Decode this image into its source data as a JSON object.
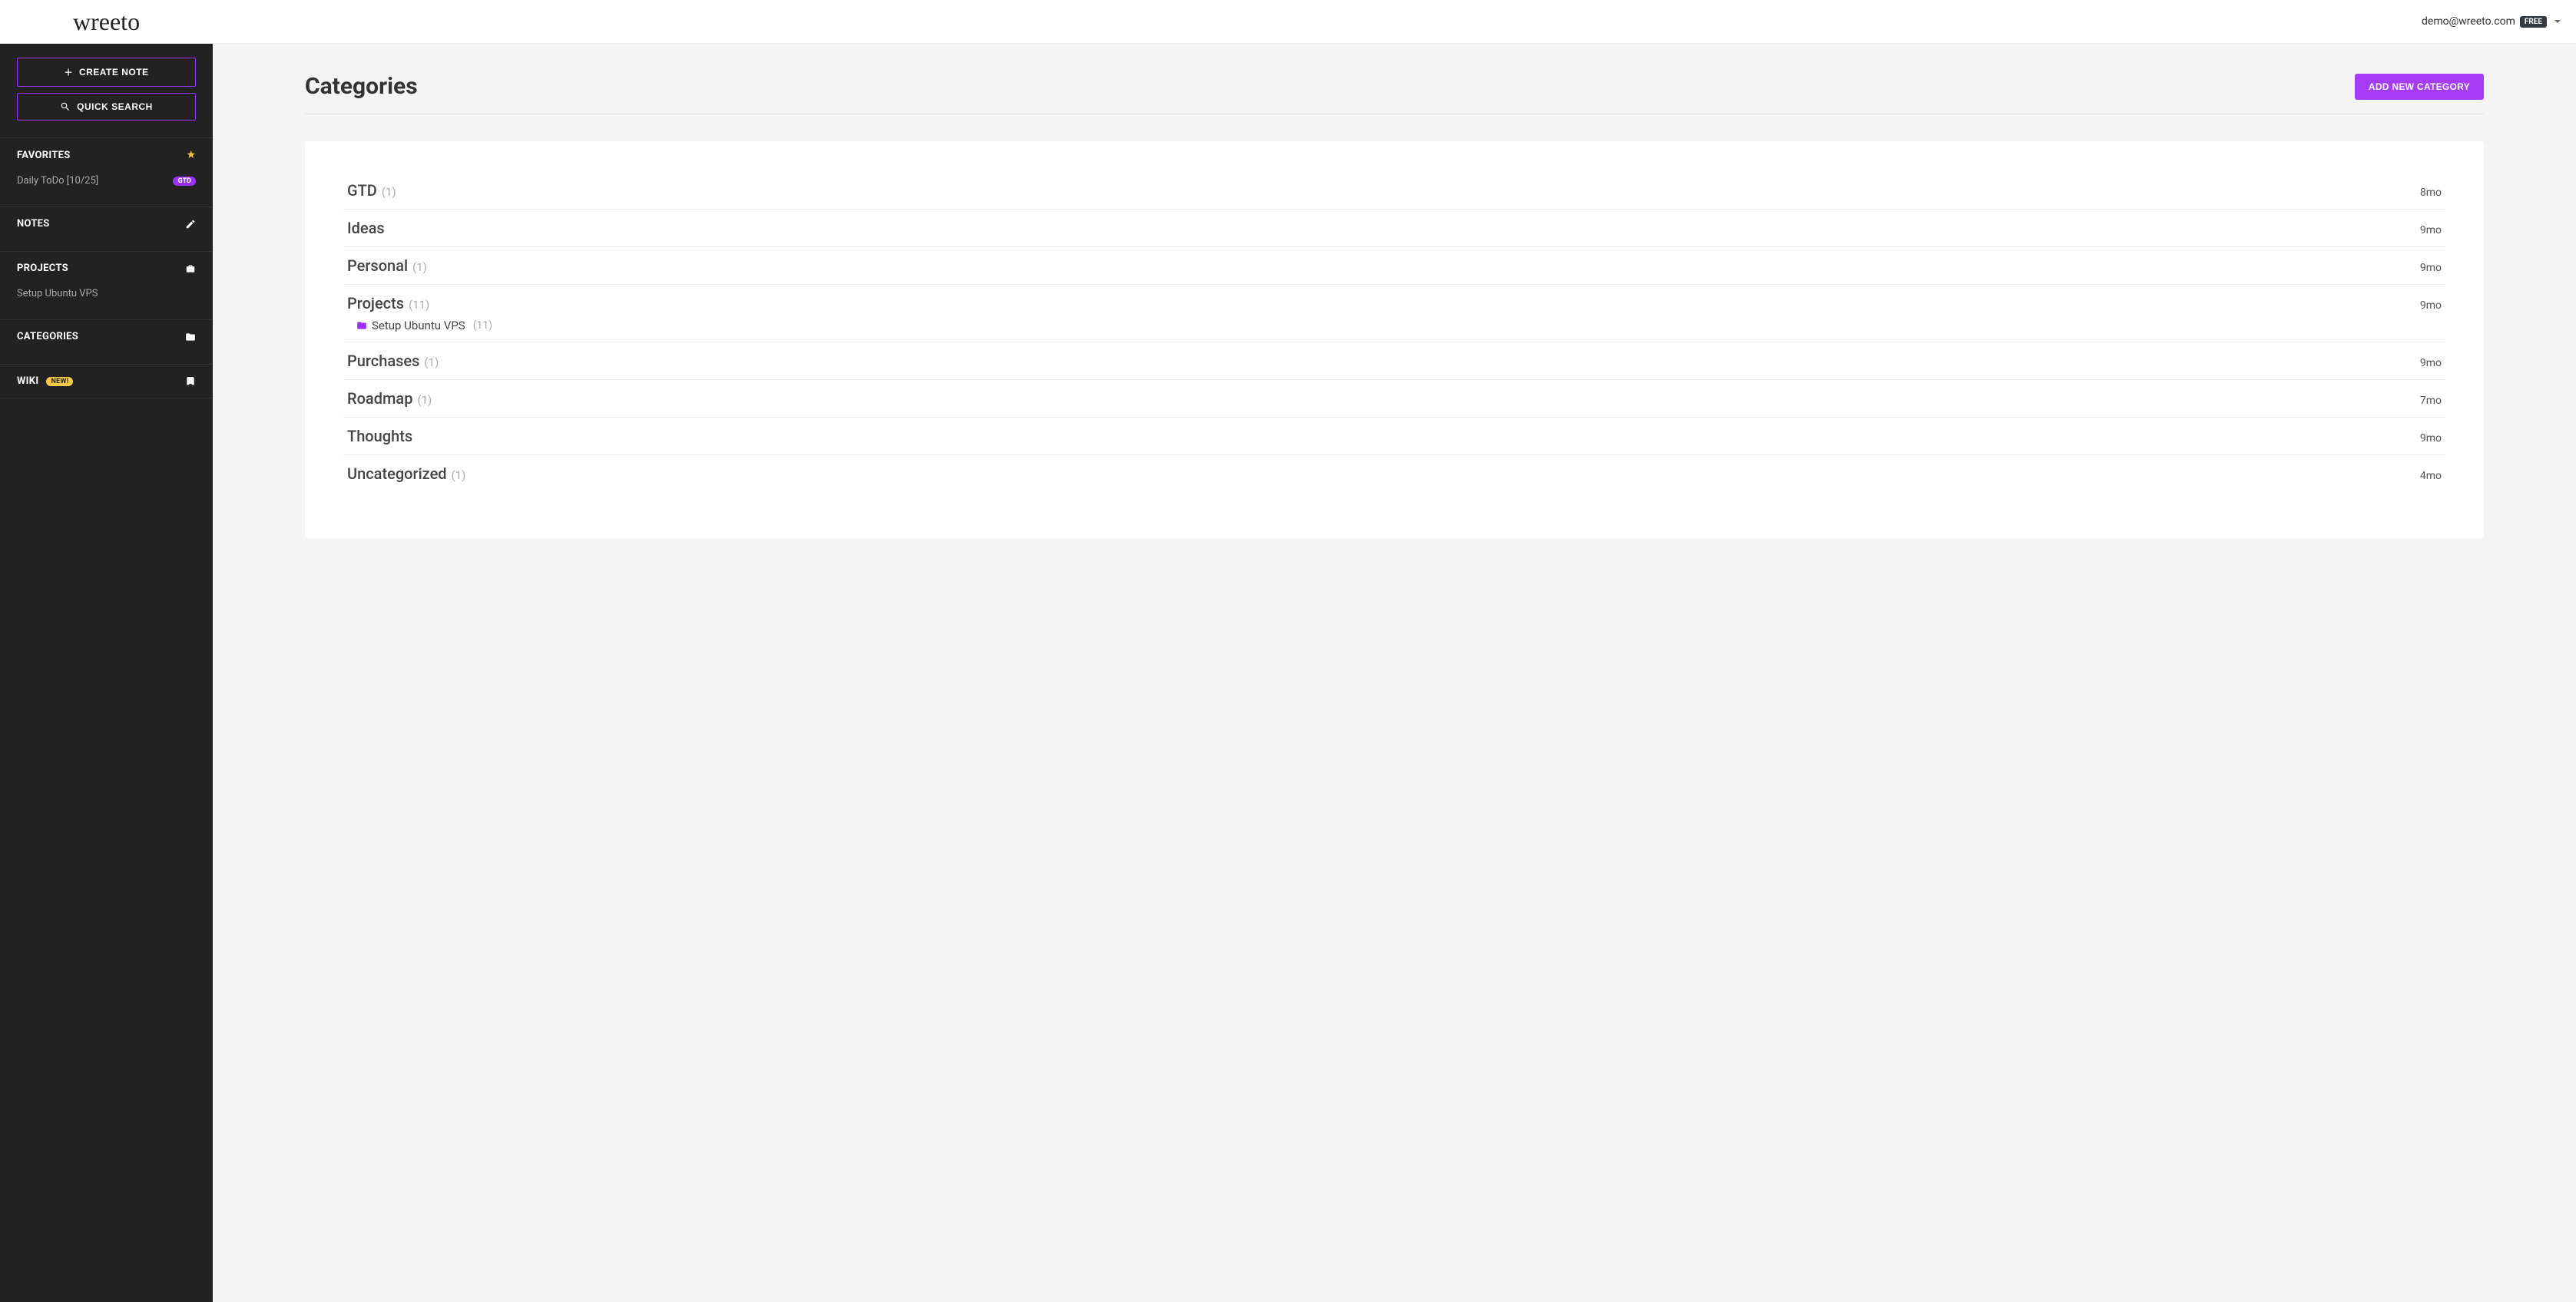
{
  "header": {
    "logo_text": "wreeto",
    "user_email": "demo@wreeto.com",
    "plan_badge": "FREE"
  },
  "sidebar": {
    "create_note_label": "CREATE NOTE",
    "quick_search_label": "QUICK SEARCH",
    "sections": {
      "favorites": {
        "label": "FAVORITES",
        "items": [
          {
            "label": "Daily ToDo [10/25]",
            "badge": "GTD"
          }
        ]
      },
      "notes": {
        "label": "NOTES"
      },
      "projects": {
        "label": "PROJECTS",
        "items": [
          {
            "label": "Setup Ubuntu VPS"
          }
        ]
      },
      "categories": {
        "label": "CATEGORIES"
      },
      "wiki": {
        "label": "WIKI",
        "badge": "NEW!"
      }
    }
  },
  "main": {
    "page_title": "Categories",
    "add_button": "ADD NEW CATEGORY",
    "categories": [
      {
        "name": "GTD",
        "count": "(1)",
        "time": "8mo"
      },
      {
        "name": "Ideas",
        "count": "",
        "time": "9mo"
      },
      {
        "name": "Personal",
        "count": "(1)",
        "time": "9mo"
      },
      {
        "name": "Projects",
        "count": "(11)",
        "time": "9mo",
        "children": [
          {
            "name": "Setup Ubuntu VPS",
            "count": "(11)"
          }
        ]
      },
      {
        "name": "Purchases",
        "count": "(1)",
        "time": "9mo"
      },
      {
        "name": "Roadmap",
        "count": "(1)",
        "time": "7mo"
      },
      {
        "name": "Thoughts",
        "count": "",
        "time": "9mo"
      },
      {
        "name": "Uncategorized",
        "count": "(1)",
        "time": "4mo"
      }
    ]
  }
}
